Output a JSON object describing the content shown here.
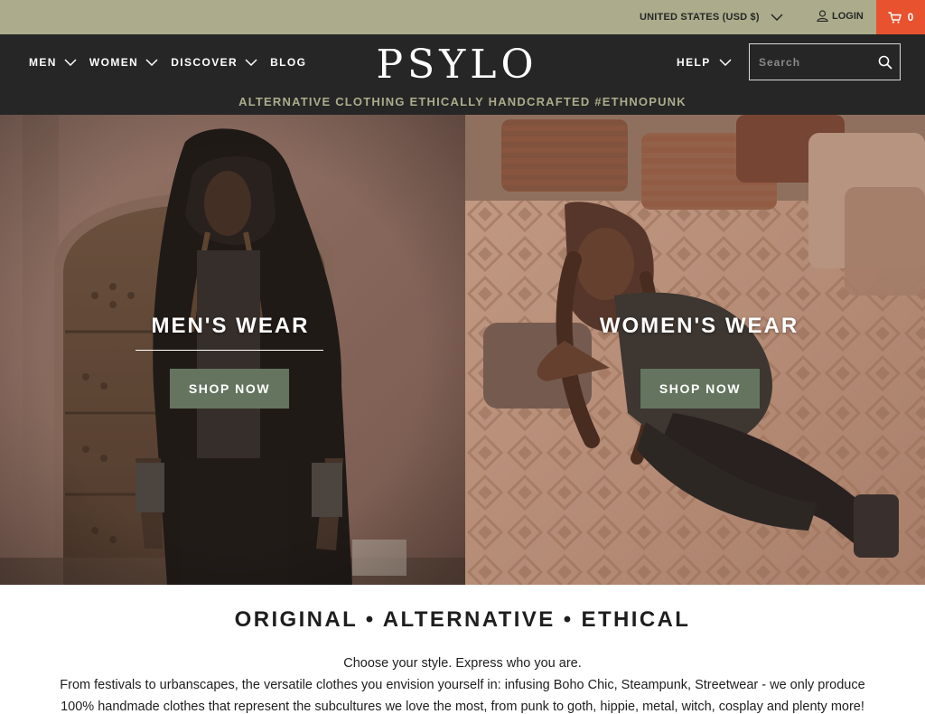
{
  "topbar": {
    "country": "UNITED STATES (USD $)",
    "login": "LOGIN",
    "cart_count": "0"
  },
  "nav": {
    "items": [
      {
        "label": "MEN"
      },
      {
        "label": "WOMEN"
      },
      {
        "label": "DISCOVER"
      },
      {
        "label": "BLOG"
      }
    ],
    "help": "HELP",
    "search_placeholder": "Search",
    "logo": "PSYLO",
    "tagline": "ALTERNATIVE CLOTHING ETHICALLY HANDCRAFTED #ETHNOPUNK"
  },
  "hero": {
    "men": {
      "title": "MEN'S WEAR",
      "button": "SHOP NOW"
    },
    "women": {
      "title": "WOMEN'S WEAR",
      "button": "SHOP NOW"
    }
  },
  "content": {
    "headline": "ORIGINAL • ALTERNATIVE • ETHICAL",
    "intro": "Choose your style. Express who you are.",
    "body_line1": "From festivals to urbanscapes, the versatile clothes you envision yourself in: infusing Boho Chic, Steampunk, Streetwear - we only produce",
    "body_line2": "100% handmade clothes that represent the subcultures we love the most, from punk to goth, hippie, metal, witch, cosplay and plenty more!"
  },
  "colors": {
    "topbar": "#acac8c",
    "navbar": "#262626",
    "cart": "#e8522f",
    "button": "#64745e",
    "tagline": "#acac8c"
  },
  "icons": [
    "chevron-down-icon",
    "user-icon",
    "cart-icon",
    "search-icon"
  ]
}
